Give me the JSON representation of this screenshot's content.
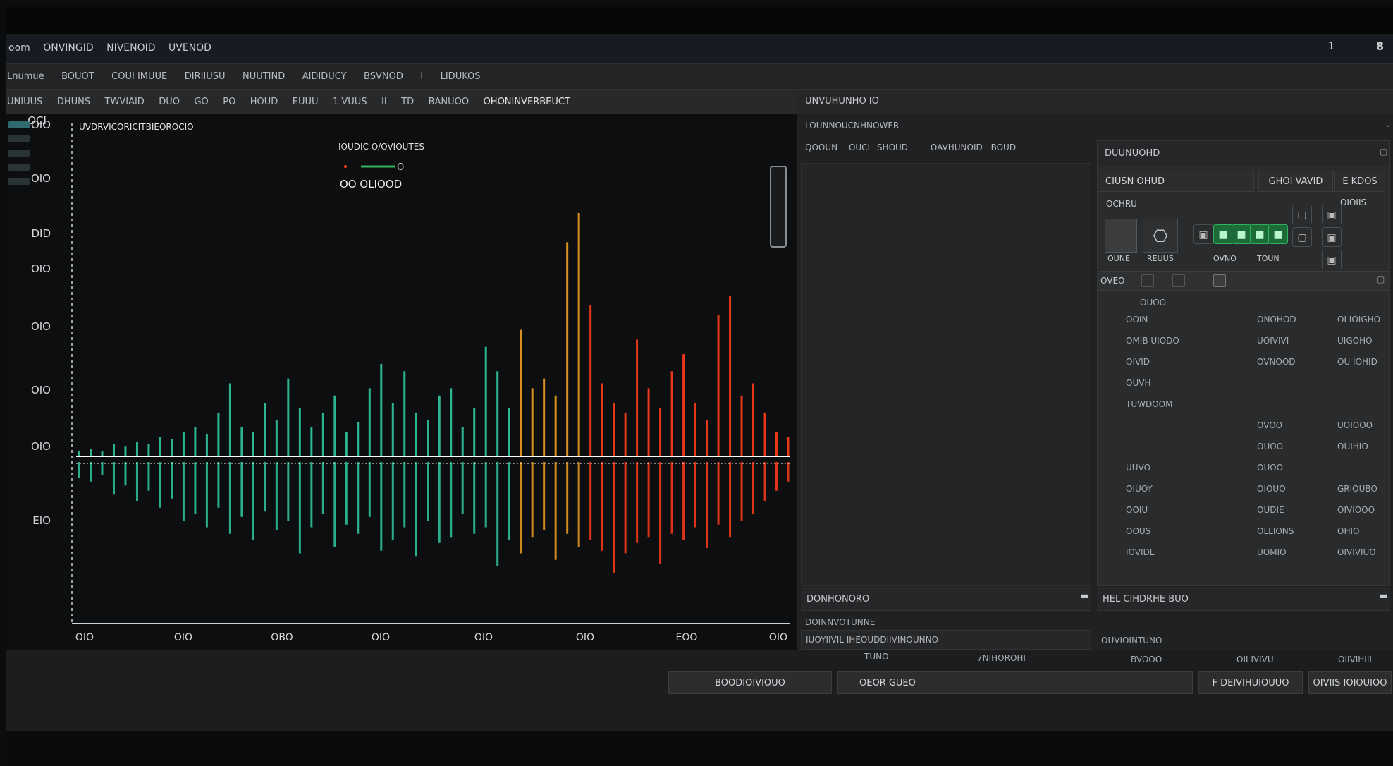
{
  "window": {
    "title_menu": [
      "oom",
      "ONVINGID",
      "NIVENOID",
      "UVENOD"
    ],
    "controls": [
      "1",
      "8"
    ]
  },
  "toolbar1": [
    "Lnumue",
    "BOUOT",
    "COUI IMUUE",
    "DIRIIUSU",
    "NUUTIND",
    "AIDIDUCY",
    "BSVNOD",
    "I",
    "LIDUKOS"
  ],
  "toolbar2": [
    "UNIUUS",
    "DHUNS",
    "TWVIAID",
    "DUO",
    "GO",
    "PO",
    "HOUD",
    "EUUU",
    "1 VUUS",
    "II",
    "TD",
    "BANUOO",
    "OHONINVERBEUCT"
  ],
  "chart": {
    "title": "UVDRVICORICITBIEOROCIO",
    "legend_title": "IOUDIC O/OVIOUTES",
    "legend_item": "O",
    "legend_value": "OO  OLIOOD",
    "corner_label": "OCI"
  },
  "chart_data": {
    "type": "line",
    "title": "UVDRVICORICITBIEOROCIO",
    "y_ticks": [
      "OIO",
      "OIO",
      "DID",
      "OIO",
      "OIO",
      "OIO",
      "OIO",
      "EIO"
    ],
    "x_ticks": [
      "OIO",
      "OIO",
      "OBO",
      "OIO",
      "OIO",
      "OIO",
      "EOO",
      "OIO"
    ],
    "series": [
      {
        "name": "O",
        "color_start": "#2fc9a0",
        "color_end": "#ff3b1a",
        "upper": [
          0.02,
          0.03,
          0.02,
          0.05,
          0.04,
          0.06,
          0.05,
          0.08,
          0.07,
          0.1,
          0.12,
          0.09,
          0.18,
          0.3,
          0.12,
          0.1,
          0.22,
          0.15,
          0.32,
          0.2,
          0.12,
          0.18,
          0.25,
          0.1,
          0.14,
          0.28,
          0.38,
          0.22,
          0.35,
          0.18,
          0.15,
          0.25,
          0.28,
          0.12,
          0.2,
          0.45,
          0.35,
          0.2,
          0.52,
          0.28,
          0.32,
          0.25,
          0.88,
          1.0,
          0.62,
          0.3,
          0.22,
          0.18,
          0.48,
          0.28,
          0.2,
          0.35,
          0.42,
          0.22,
          0.15,
          0.58,
          0.66,
          0.25,
          0.3,
          0.18,
          0.1,
          0.08
        ],
        "lower": [
          0.12,
          0.15,
          0.1,
          0.25,
          0.18,
          0.3,
          0.22,
          0.35,
          0.28,
          0.45,
          0.4,
          0.5,
          0.35,
          0.55,
          0.42,
          0.6,
          0.38,
          0.52,
          0.45,
          0.7,
          0.5,
          0.4,
          0.65,
          0.48,
          0.55,
          0.42,
          0.68,
          0.6,
          0.5,
          0.72,
          0.45,
          0.62,
          0.58,
          0.4,
          0.55,
          0.5,
          0.8,
          0.6,
          0.7,
          0.58,
          0.52,
          0.75,
          0.55,
          0.65,
          0.6,
          0.68,
          0.85,
          0.7,
          0.62,
          0.58,
          0.78,
          0.55,
          0.6,
          0.5,
          0.66,
          0.48,
          0.58,
          0.45,
          0.4,
          0.3,
          0.22,
          0.15
        ]
      }
    ]
  },
  "right": {
    "panel_title": "UNVUHUNHO IO",
    "subtitle": "LOUNNOUCNHNOWER",
    "tabs": [
      "QOOUN",
      "OUCI",
      "SHOUD",
      "OAVHUNOID",
      "BOUD"
    ],
    "inspector_title": "DUUNUOHD",
    "field_value": "CIUSN OHUD",
    "btn_a": "GHOI VAVID",
    "btn_b": "E KDOS",
    "tools_label": "OCHRU",
    "tools_right": "OIOIIS",
    "tool_labels": [
      "OUNE",
      "REUUS",
      "OVNO",
      "TOUN"
    ],
    "mini_toolbar_label": "OVEO",
    "table_top": "OUOO",
    "rows": [
      [
        "OOIN",
        "ONOHOD",
        "OI IOIGHO"
      ],
      [
        "OMIB  UIODO",
        "UOIVIVI",
        "UIGOHO"
      ],
      [
        "OIVID",
        "OVNOOD",
        "OU IOHID"
      ],
      [
        "OUVH",
        "",
        ""
      ],
      [
        "TUWDOOM",
        "",
        ""
      ],
      [
        "",
        "OVOO",
        "UOIOOO"
      ],
      [
        "",
        "OUOO",
        "OUIHIO"
      ],
      [
        "UUVO",
        "OUOO",
        ""
      ],
      [
        "OIUOY",
        "OIOUO",
        "GRIOUBO"
      ],
      [
        "OOIU",
        "OUDIE",
        "OIVIOOO"
      ],
      [
        "OOUS",
        "OLLIONS",
        "OHIO"
      ],
      [
        "IOVIDL",
        "UOMIO",
        "OIVIVIUO"
      ]
    ],
    "section_left": "DONHONORO",
    "section_right": "HEL CIHDRHE BUO",
    "sub_left": "DOINNVOTUNNE",
    "sub_left2": "IUOYIIVIL IHEOUDDIIVINOUNNO",
    "sub_right": "OUVIOINTUNO",
    "footer_labels": [
      "TUNO",
      "7NIHOROHI",
      "BVOOO",
      "OII IVIVU",
      "OIIVIHIIL"
    ]
  },
  "status": {
    "btn1": "BOODIOIVIOUO",
    "field": "OEOR GUEO",
    "btn2": "F DEIVIHUIOUUO",
    "btn3": "OIVIIS IOIOUIOO"
  },
  "colors": {
    "accent_green": "#2fb25b",
    "wave_teal": "#2fc9a0",
    "wave_red": "#ff3b1a",
    "baseline": "#ffffff"
  }
}
